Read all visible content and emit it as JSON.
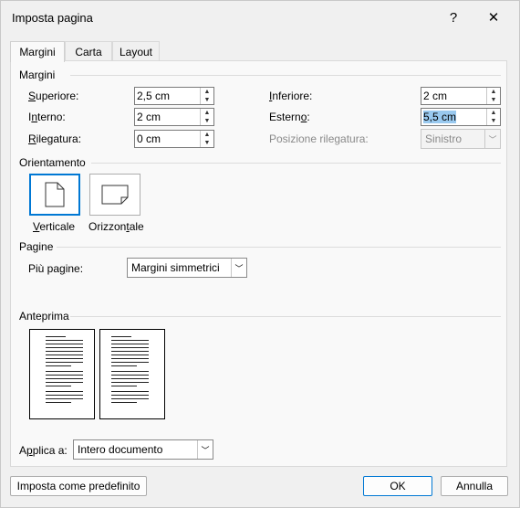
{
  "window": {
    "title": "Imposta pagina",
    "help": "?",
    "close": "✕"
  },
  "tabs": [
    {
      "label": "Margini",
      "active": true
    },
    {
      "label": "Carta",
      "active": false
    },
    {
      "label": "Layout",
      "active": false
    }
  ],
  "margins": {
    "group_title": "Margini",
    "superiore": {
      "label": "Superiore:",
      "value": "2,5 cm"
    },
    "interno": {
      "label": "Interno:",
      "value": "2 cm"
    },
    "rilegatura": {
      "label": "Rilegatura:",
      "value": "0 cm"
    },
    "inferiore": {
      "label": "Inferiore:",
      "value": "2 cm"
    },
    "esterno": {
      "label": "Esterno:",
      "value": "5,5 cm"
    },
    "posizione": {
      "label": "Posizione rilegatura:",
      "value": "Sinistro"
    }
  },
  "orientation": {
    "group_title": "Orientamento",
    "vertical_label": "Verticale",
    "horizontal_label": "Orizzontale",
    "selected": "Verticale"
  },
  "pages": {
    "group_title": "Pagine",
    "multiple_label": "Più pagine:",
    "multiple_value": "Margini simmetrici"
  },
  "preview": {
    "group_title": "Anteprima"
  },
  "apply": {
    "label": "Applica a:",
    "value": "Intero documento"
  },
  "footer": {
    "default_button": "Imposta come predefinito",
    "ok_button": "OK",
    "cancel_button": "Annulla"
  },
  "colors": {
    "accent": "#0078d4",
    "selection": "#99c9ef"
  }
}
